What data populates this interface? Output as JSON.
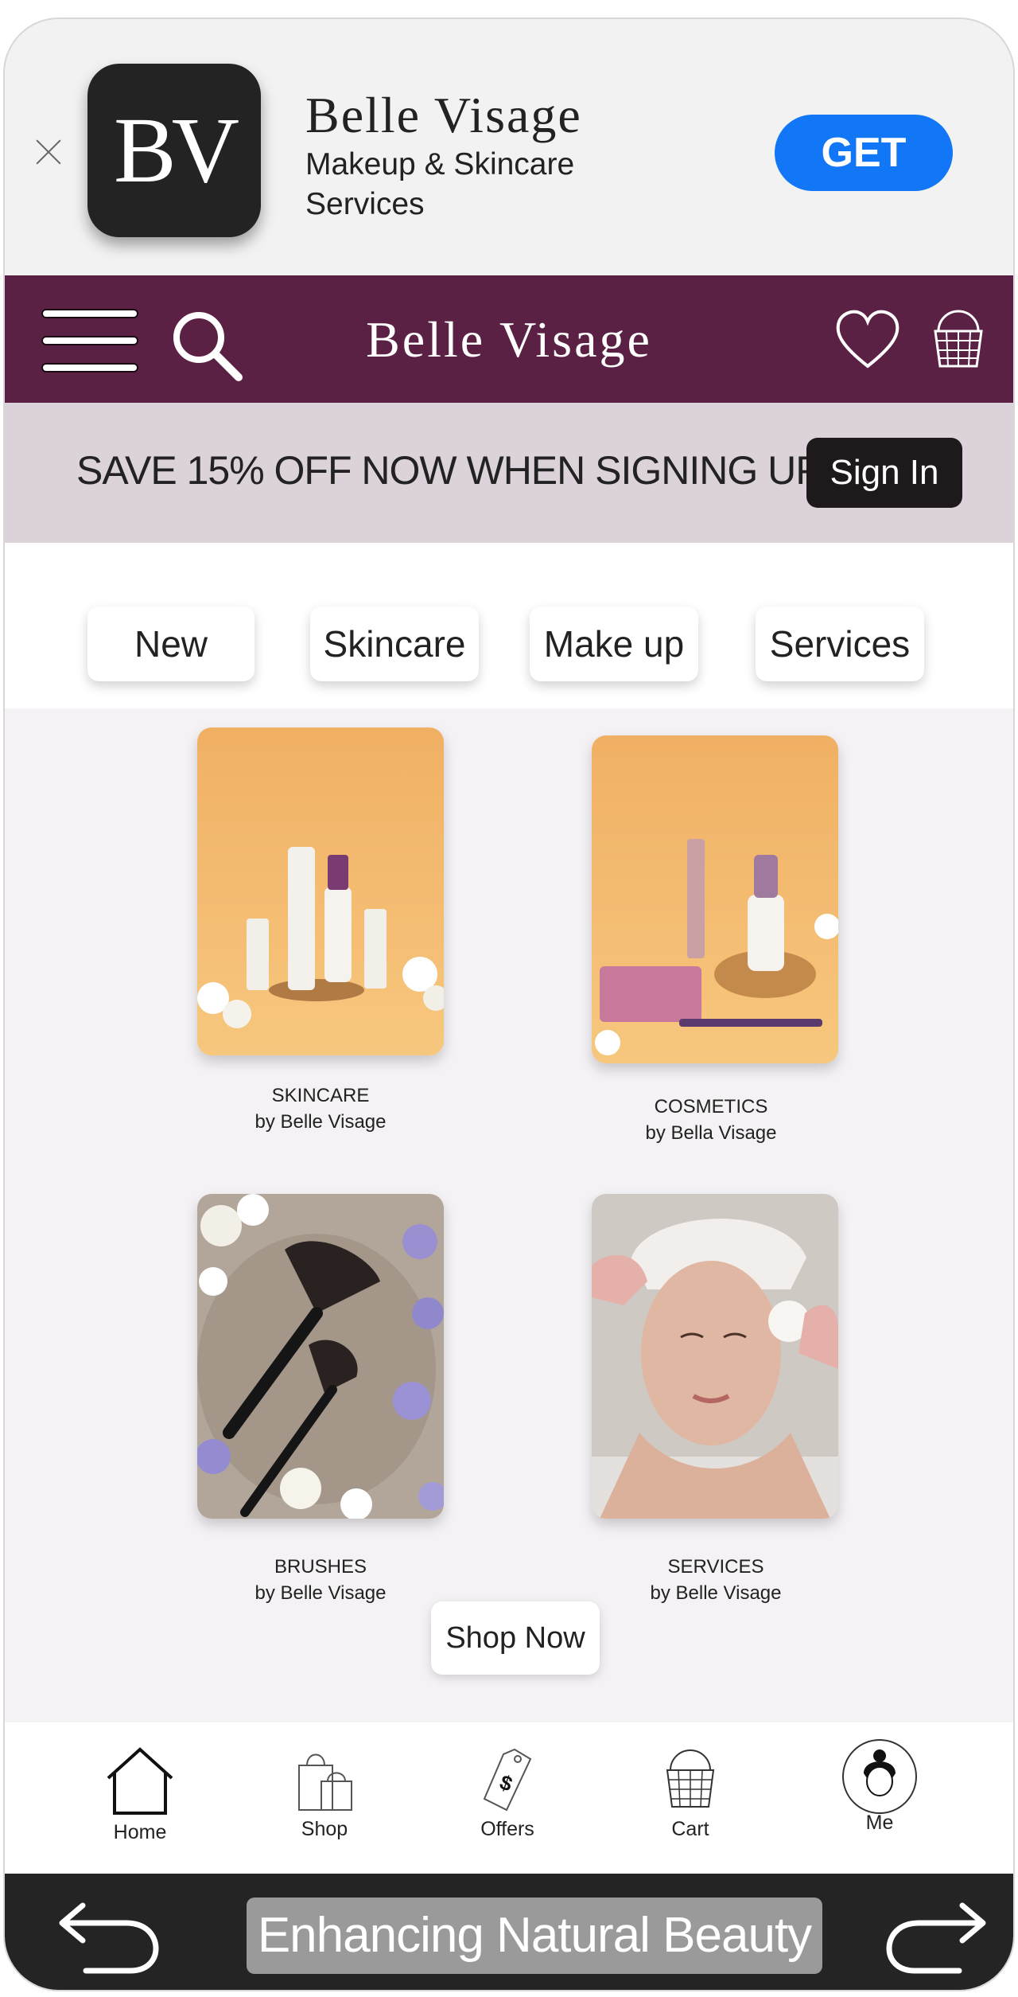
{
  "banner": {
    "app_icon_text": "BV",
    "app_name": "Belle Visage",
    "app_subtitle": "Makeup & Skincare Services",
    "get_label": "GET"
  },
  "header": {
    "brand": "Belle Visage"
  },
  "promo": {
    "text": "SAVE 15% OFF NOW WHEN SIGNING UP",
    "signin_label": "Sign In"
  },
  "categories": [
    "New",
    "Skincare",
    "Make up",
    "Services"
  ],
  "products": [
    {
      "name": "SKINCARE",
      "by": "by Belle Visage"
    },
    {
      "name": "COSMETICS",
      "by": "by Bella Visage"
    },
    {
      "name": "BRUSHES",
      "by": "by Belle Visage"
    },
    {
      "name": "SERVICES",
      "by": "by Belle Visage"
    }
  ],
  "shop_now_label": "Shop Now",
  "tabbar": [
    {
      "label": "Home",
      "icon": "home-icon"
    },
    {
      "label": "Shop",
      "icon": "shopping-bags-icon"
    },
    {
      "label": "Offers",
      "icon": "price-tag-icon"
    },
    {
      "label": "Cart",
      "icon": "basket-icon"
    },
    {
      "label": "Me",
      "icon": "profile-icon"
    }
  ],
  "bottombar": {
    "tagline": "Enhancing Natural Beauty"
  },
  "colors": {
    "header": "#5b2145",
    "promo": "#dcd2da",
    "get_button": "#1177f6",
    "bottom_bar": "#242424"
  }
}
